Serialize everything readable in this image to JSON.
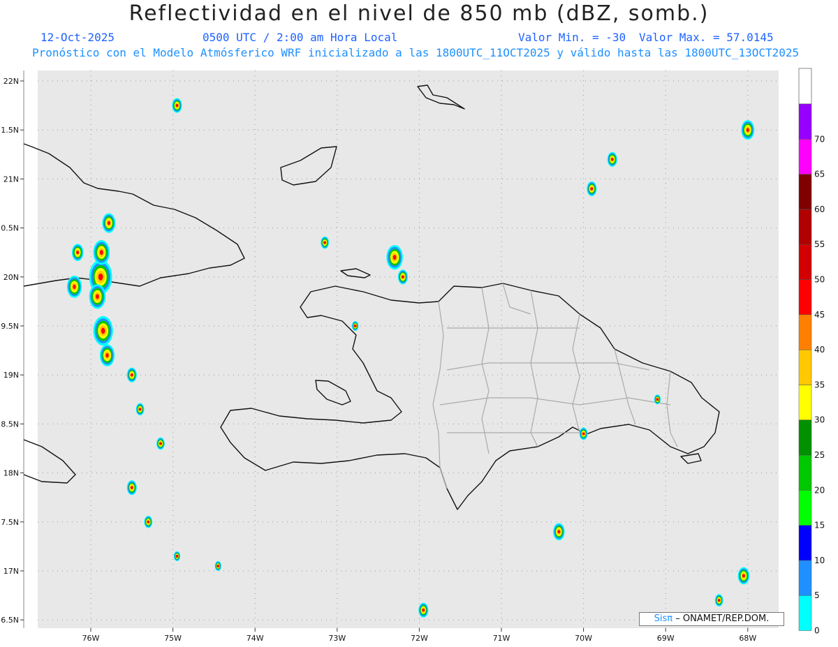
{
  "header": {
    "title": "Reflectividad en el nivel de 850 mb (dBZ, somb.)",
    "date": "12-Oct-2025",
    "time": "0500 UTC / 2:00 am Hora Local",
    "valmin": "Valor Min. = -30",
    "valmax": "Valor Max. = 57.0145",
    "forecast": "Pronóstico con el Modelo Atmósferico WRF inicializado a las 1800UTC_11OCT2025 y válido hasta las  1800UTC_13OCT2025"
  },
  "axes": {
    "lon_ticks": [
      "76W",
      "75W",
      "74W",
      "73W",
      "72W",
      "71W",
      "70W",
      "69W",
      "68W"
    ],
    "lat_ticks": [
      "22N",
      "1.5N",
      "21N",
      "0.5N",
      "20N",
      "9.5N",
      "19N",
      "8.5N",
      "18N",
      "7.5N",
      "17N",
      "6.5N"
    ]
  },
  "colorbar": {
    "labels": [
      "0",
      "5",
      "10",
      "15",
      "20",
      "25",
      "30",
      "35",
      "40",
      "45",
      "50",
      "55",
      "60",
      "65",
      "70"
    ],
    "colors": [
      "#00ffff",
      "#1e90ff",
      "#0000ff",
      "#00ff00",
      "#00c800",
      "#009000",
      "#ffff00",
      "#ffc800",
      "#ff8000",
      "#ff0000",
      "#d20000",
      "#b00000",
      "#800000",
      "#ff00ff",
      "#9600ff"
    ],
    "background": "#e8e8e8"
  },
  "credit": {
    "brand": "Sisπ",
    "text": "– ONAMET/REP.DOM."
  },
  "map": {
    "background": "#e8e8e8",
    "storm_cells": [
      {
        "lon": -75.88,
        "lat": 20.0,
        "r": 0.14
      },
      {
        "lon": -75.87,
        "lat": 20.25,
        "r": 0.1
      },
      {
        "lon": -75.92,
        "lat": 19.8,
        "r": 0.1
      },
      {
        "lon": -75.85,
        "lat": 19.45,
        "r": 0.12
      },
      {
        "lon": -75.8,
        "lat": 19.2,
        "r": 0.09
      },
      {
        "lon": -75.78,
        "lat": 20.55,
        "r": 0.08
      },
      {
        "lon": -76.2,
        "lat": 19.9,
        "r": 0.09
      },
      {
        "lon": -76.16,
        "lat": 20.25,
        "r": 0.07
      },
      {
        "lon": -75.5,
        "lat": 19.0,
        "r": 0.06
      },
      {
        "lon": -75.4,
        "lat": 18.65,
        "r": 0.05
      },
      {
        "lon": -75.15,
        "lat": 18.3,
        "r": 0.05
      },
      {
        "lon": -75.5,
        "lat": 17.85,
        "r": 0.06
      },
      {
        "lon": -75.3,
        "lat": 17.5,
        "r": 0.05
      },
      {
        "lon": -74.95,
        "lat": 21.75,
        "r": 0.06
      },
      {
        "lon": -72.3,
        "lat": 20.2,
        "r": 0.1
      },
      {
        "lon": -72.2,
        "lat": 20.0,
        "r": 0.06
      },
      {
        "lon": -73.15,
        "lat": 20.35,
        "r": 0.05
      },
      {
        "lon": -72.78,
        "lat": 19.5,
        "r": 0.04
      },
      {
        "lon": -70.0,
        "lat": 18.4,
        "r": 0.05
      },
      {
        "lon": -69.1,
        "lat": 18.75,
        "r": 0.04
      },
      {
        "lon": -70.3,
        "lat": 17.4,
        "r": 0.07
      },
      {
        "lon": -69.65,
        "lat": 21.2,
        "r": 0.06
      },
      {
        "lon": -69.9,
        "lat": 20.9,
        "r": 0.06
      },
      {
        "lon": -68.0,
        "lat": 21.5,
        "r": 0.08
      },
      {
        "lon": -68.05,
        "lat": 16.95,
        "r": 0.07
      },
      {
        "lon": -68.35,
        "lat": 16.7,
        "r": 0.05
      },
      {
        "lon": -71.95,
        "lat": 16.6,
        "r": 0.06
      },
      {
        "lon": -74.45,
        "lat": 17.05,
        "r": 0.04
      },
      {
        "lon": -74.95,
        "lat": 17.15,
        "r": 0.04
      }
    ]
  }
}
